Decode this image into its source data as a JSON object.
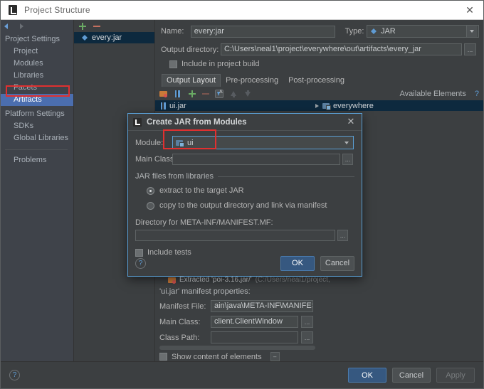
{
  "window": {
    "title": "Project Structure",
    "icon": "intellij-icon",
    "close_label": "✕"
  },
  "sidebar": {
    "back_icon": "arrow-left-icon",
    "forward_icon": "arrow-right-icon",
    "groups": [
      {
        "title": "Project Settings",
        "items": [
          {
            "label": "Project",
            "selected": false
          },
          {
            "label": "Modules",
            "selected": false
          },
          {
            "label": "Libraries",
            "selected": false
          },
          {
            "label": "Facets",
            "selected": false
          },
          {
            "label": "Artifacts",
            "selected": true
          }
        ]
      },
      {
        "title": "Platform Settings",
        "items": [
          {
            "label": "SDKs",
            "selected": false
          },
          {
            "label": "Global Libraries",
            "selected": false
          }
        ]
      }
    ],
    "problems_label": "Problems"
  },
  "artifact_list": {
    "add_icon": "plus-icon",
    "remove_icon": "minus-icon",
    "items": [
      {
        "label": "every:jar",
        "icon": "jar-artifact-icon",
        "selected": true
      }
    ]
  },
  "editor": {
    "name_label": "Name:",
    "name_value": "every:jar",
    "type_label": "Type:",
    "type_value": "JAR",
    "type_icon": "jar-artifact-icon",
    "output_dir_label": "Output directory:",
    "output_dir_value": "C:\\Users\\neal1\\project\\everywhere\\out\\artifacts\\every_jar",
    "browse_label": "...",
    "include_in_build_label": "Include in project build",
    "include_in_build_checked": false,
    "tabs": [
      {
        "label": "Output Layout",
        "active": true
      },
      {
        "label": "Pre-processing",
        "active": false
      },
      {
        "label": "Post-processing",
        "active": false
      }
    ],
    "toolbar": [
      {
        "icon": "create-archive-icon"
      },
      {
        "icon": "jar-file-icon"
      },
      {
        "icon": "add-copy-icon"
      },
      {
        "icon": "remove-icon"
      },
      {
        "icon": "sort-alphabetically-icon"
      },
      {
        "icon": "move-up-icon"
      },
      {
        "icon": "move-down-icon"
      }
    ],
    "layout_tree": [
      {
        "label": "ui.jar",
        "icon": "jar-file-icon",
        "selected": true
      }
    ],
    "available_elements_label": "Available Elements",
    "available_help_label": "?",
    "available_tree": [
      {
        "label": "everywhere",
        "icon": "module-icon",
        "expander": "collapsed-triangle-icon"
      }
    ],
    "extracted_row": {
      "icon": "extracted-archive-icon",
      "label": "Extracted 'poi-3.16.jar/'",
      "path": "(C:/Users/neal1/project,"
    },
    "manifest_section_title": "'ui.jar' manifest properties:",
    "manifest_file_label": "Manifest File:",
    "manifest_file_value": "ain\\java\\META-INF\\MANIFEST.MF",
    "main_class_label": "Main Class:",
    "main_class_value": "client.ClientWindow",
    "class_path_label": "Class Path:",
    "class_path_value": "",
    "show_content_label": "Show content of elements",
    "show_content_checked": false,
    "collapse_label": "–"
  },
  "dialog": {
    "icon": "intellij-icon",
    "title": "Create JAR from Modules",
    "close_label": "✕",
    "module_label": "Module:",
    "module_value": "ui",
    "module_icon": "module-icon",
    "main_class_label": "Main Class:",
    "main_class_value": "",
    "main_class_browse": "...",
    "jar_libraries_section": "JAR files from libraries",
    "radio_extract_label": "extract to the target JAR",
    "radio_copy_label": "copy to the output directory and link via manifest",
    "radio_selected": "extract",
    "manifest_dir_label": "Directory for META-INF/MANIFEST.MF:",
    "manifest_dir_value": "",
    "manifest_dir_browse": "...",
    "include_tests_label": "Include tests",
    "include_tests_checked": false,
    "help_label": "?",
    "ok_label": "OK",
    "cancel_label": "Cancel"
  },
  "footer": {
    "help_label": "?",
    "ok_label": "OK",
    "cancel_label": "Cancel",
    "apply_label": "Apply"
  },
  "annotations": {
    "highlight_color": "#e03030",
    "boxes": [
      "artifacts-sidebar-item",
      "module-combo-field"
    ]
  },
  "colors": {
    "accent_blue": "#4b6eaf",
    "selection_dark": "#0d293e",
    "panel_bg": "#3c3f41",
    "nav_bg": "#3f434a",
    "primary_button": "#365880"
  }
}
